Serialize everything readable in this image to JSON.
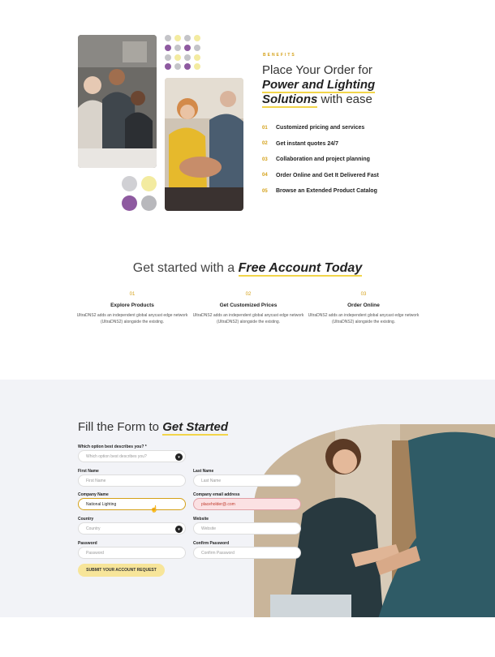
{
  "benefits": {
    "eyebrow": "BENEFITS",
    "title_line1": "Place Your Order for",
    "title_em1": "Power and Lighting",
    "title_em2": "Solutions",
    "title_tail": "with ease",
    "items": [
      {
        "num": "01",
        "label": "Customized pricing and services"
      },
      {
        "num": "02",
        "label": "Get instant quotes 24/7"
      },
      {
        "num": "03",
        "label": "Collaboration and project planning"
      },
      {
        "num": "04",
        "label": "Order Online and Get It Delivered Fast"
      },
      {
        "num": "05",
        "label": "Browse an Extended Product Catalog"
      }
    ]
  },
  "get_started": {
    "title_plain": "Get started with a",
    "title_em": "Free Account Today",
    "steps": [
      {
        "num": "01",
        "head": "Explore Products",
        "desc": "UltraDNS2 adds an independent global anycast edge network (UltraDNS2) alongside the existing."
      },
      {
        "num": "02",
        "head": "Get Customized Prices",
        "desc": "UltraDNS2 adds an independent global anycast edge network (UltraDNS2) alongside the existing."
      },
      {
        "num": "03",
        "head": "Order Online",
        "desc": "UltraDNS2 adds an independent global anycast edge network (UltraDNS2) alongside the existing."
      }
    ]
  },
  "form": {
    "title_plain": "Fill the Form to",
    "title_em": "Get Started",
    "describe_label": "Which option best describes you? *",
    "describe_placeholder": "Which option best describes you?",
    "first_name_label": "First Name",
    "first_name_placeholder": "First Name",
    "last_name_label": "Last Name",
    "last_name_placeholder": "Last Name",
    "company_label": "Company Name",
    "company_value": "National Lighting",
    "email_label": "Company email address",
    "email_value": "placeholder@.com",
    "country_label": "Country",
    "country_placeholder": "Country",
    "website_label": "Website",
    "website_placeholder": "Website",
    "password_label": "Password",
    "password_placeholder": "Password",
    "confirm_label": "Confirm Password",
    "confirm_placeholder": "Confirm Password",
    "submit_label": "SUBMIT YOUR ACCOUNT REQUEST"
  },
  "colors": {
    "accent_gold": "#d4a017",
    "highlight_yellow": "#f2d54a",
    "dot_purple": "#8e5aa0",
    "dot_grey": "#c4c4c8",
    "dot_yellow": "#f3eba0",
    "form_bg": "#f2f3f7"
  },
  "icons": {
    "select_caret": "chevron-down-icon",
    "cursor": "hand-cursor-icon"
  }
}
